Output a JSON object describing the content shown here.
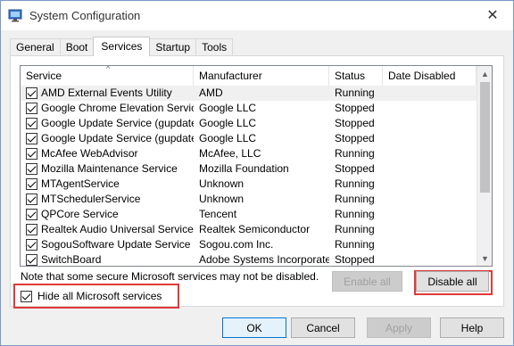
{
  "window": {
    "title": "System Configuration"
  },
  "tabs": [
    {
      "label": "General",
      "active": false
    },
    {
      "label": "Boot",
      "active": false
    },
    {
      "label": "Services",
      "active": true
    },
    {
      "label": "Startup",
      "active": false
    },
    {
      "label": "Tools",
      "active": false
    }
  ],
  "services_table": {
    "columns": [
      "Service",
      "Manufacturer",
      "Status",
      "Date Disabled"
    ],
    "rows": [
      {
        "service": "AMD External Events Utility",
        "manufacturer": "AMD",
        "status": "Running",
        "date_disabled": "",
        "checked": true
      },
      {
        "service": "Google Chrome Elevation Service",
        "manufacturer": "Google LLC",
        "status": "Stopped",
        "date_disabled": "",
        "checked": true
      },
      {
        "service": "Google Update Service (gupdate)",
        "manufacturer": "Google LLC",
        "status": "Stopped",
        "date_disabled": "",
        "checked": true
      },
      {
        "service": "Google Update Service (gupdatem)",
        "manufacturer": "Google LLC",
        "status": "Stopped",
        "date_disabled": "",
        "checked": true
      },
      {
        "service": "McAfee WebAdvisor",
        "manufacturer": "McAfee, LLC",
        "status": "Running",
        "date_disabled": "",
        "checked": true
      },
      {
        "service": "Mozilla Maintenance Service",
        "manufacturer": "Mozilla Foundation",
        "status": "Stopped",
        "date_disabled": "",
        "checked": true
      },
      {
        "service": "MTAgentService",
        "manufacturer": "Unknown",
        "status": "Running",
        "date_disabled": "",
        "checked": true
      },
      {
        "service": "MTSchedulerService",
        "manufacturer": "Unknown",
        "status": "Running",
        "date_disabled": "",
        "checked": true
      },
      {
        "service": "QPCore Service",
        "manufacturer": "Tencent",
        "status": "Running",
        "date_disabled": "",
        "checked": true
      },
      {
        "service": "Realtek Audio Universal Service",
        "manufacturer": "Realtek Semiconductor",
        "status": "Running",
        "date_disabled": "",
        "checked": true
      },
      {
        "service": "SogouSoftware Update Service ...",
        "manufacturer": "Sogou.com Inc.",
        "status": "Running",
        "date_disabled": "",
        "checked": true
      },
      {
        "service": "SwitchBoard",
        "manufacturer": "Adobe Systems Incorporated",
        "status": "Stopped",
        "date_disabled": "",
        "checked": true
      }
    ]
  },
  "note": "Note that some secure Microsoft services may not be disabled.",
  "buttons": {
    "enable_all": "Enable all",
    "disable_all": "Disable all",
    "ok": "OK",
    "cancel": "Cancel",
    "apply": "Apply",
    "help": "Help"
  },
  "hide_ms": {
    "label": "Hide all Microsoft services",
    "checked": true
  },
  "colors": {
    "highlight_border": "#e03a3a",
    "ok_border": "#0078d7"
  }
}
